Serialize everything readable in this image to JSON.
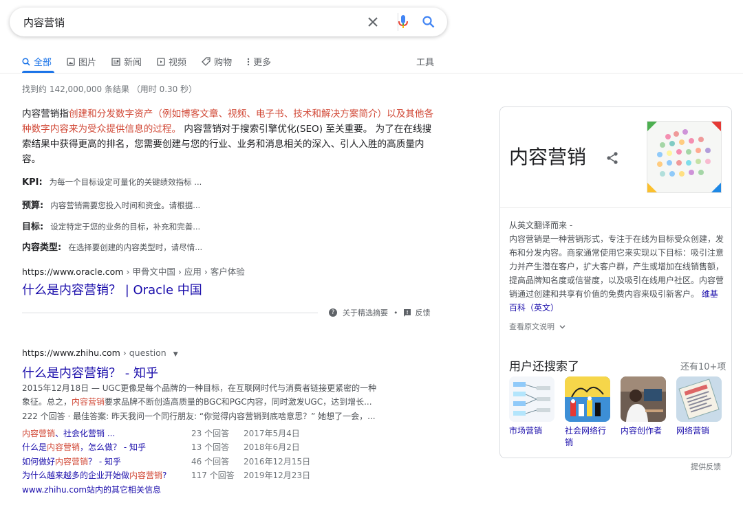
{
  "search": {
    "query": "内容营销"
  },
  "tabs": [
    {
      "label": "全部",
      "icon": "search-icon"
    },
    {
      "label": "图片",
      "icon": "image-icon"
    },
    {
      "label": "新闻",
      "icon": "news-icon"
    },
    {
      "label": "视频",
      "icon": "video-icon"
    },
    {
      "label": "购物",
      "icon": "tag-icon"
    },
    {
      "label": "更多",
      "icon": "more-dots-icon"
    }
  ],
  "tools_label": "工具",
  "stats": "找到约 142,000,000 条结果 （用时 0.30 秒）",
  "featured": {
    "lead": "内容营销指",
    "highlight": "创建和分发数字资产（例如博客文章、视频、电子书、技术和解决方案简介）以及其他各种数字内容来为受众提供信息的过程。",
    "rest": " 内容营销对于搜索引擎优化(SEO) 至关重要。 为了在在线搜索结果中获得更高的排名，您需要创建与您的行业、业务和消息相关的深入、引人入胜的高质量内容。",
    "items": [
      {
        "key": "KPI:",
        "value": "为每一个目标设定可量化的关键绩效指标 ..."
      },
      {
        "key": "预算:",
        "value": "内容营销需要您投入时间和资金。请根据..."
      },
      {
        "key": "目标:",
        "value": "设定特定于您的业务的目标，补充和完善..."
      },
      {
        "key": "内容类型:",
        "value": "在选择要创建的内容类型时，请尽情..."
      }
    ],
    "url": "https://www.oracle.com",
    "breadcrumb": " › 甲骨文中国 › 应用 › 客户体验",
    "title": "什么是内容营销？ | Oracle 中国",
    "about_label": "关于精选摘要",
    "dot": "•",
    "feedback_label": "反馈"
  },
  "result2": {
    "url": "https://www.zhihu.com",
    "breadcrumb": " › question",
    "title": "什么是内容营销？ - 知乎",
    "desc1": "2015年12月18日 — UGC更像是每个品牌的一种目标，在互联网时代与消费者链接更紧密的一种",
    "desc2_a": "象征。总之，",
    "desc2_hl": "内容营销",
    "desc2_b": "要求品牌不断创造高质量的BGC和PGC内容，同时激发UGC，达到增长...",
    "desc3": "222 个回答 · 最佳答案: 昨天我问一个同行朋友: “你觉得内容营销到底啥意思？” 她想了一会，...",
    "subs": [
      {
        "pre": "",
        "hl": "内容营销",
        "post": "、社会化营销 ...",
        "count": "23 个回答",
        "date": "2017年5月4日"
      },
      {
        "pre": "什么是",
        "hl": "内容营销",
        "post": "，怎么做？ - 知乎",
        "count": "13 个回答",
        "date": "2018年6月2日"
      },
      {
        "pre": "如何做好",
        "hl": "内容营销",
        "post": "？ - 知乎",
        "count": "46 个回答",
        "date": "2016年12月15日"
      },
      {
        "pre": "为什么越来越多的企业开始做",
        "hl": "内容营销",
        "post": "?",
        "count": "117 个回答",
        "date": "2019年12月23日"
      }
    ],
    "more_link": "www.zhihu.com站内的其它相关信息"
  },
  "kp": {
    "title": "内容营销",
    "translated_from": "从英文翻译而来 -",
    "description": "内容营销是一种营销形式，专注于在线为目标受众创建，发布和分发内容。商家通常使用它来实现以下目标：吸引注意力并产生潜在客户，扩大客户群，产生或增加在线销售额，提高品牌知名度或信誉度，以及吸引在线用户社区。内容营销通过创建和共享有价值的免费内容来吸引新客户。",
    "wiki_link": "维基百科（英文）",
    "view_original": "查看原文说明",
    "people_also": "用户还搜索了",
    "more_count": "还有10+项",
    "thumbs": [
      "市场营销",
      "社会网络行销",
      "内容创作者",
      "网络营销"
    ],
    "feedback": "提供反馈"
  },
  "colors": {
    "link": "#1a0dab",
    "accent": "#1a73e8",
    "highlight": "#d14836"
  }
}
